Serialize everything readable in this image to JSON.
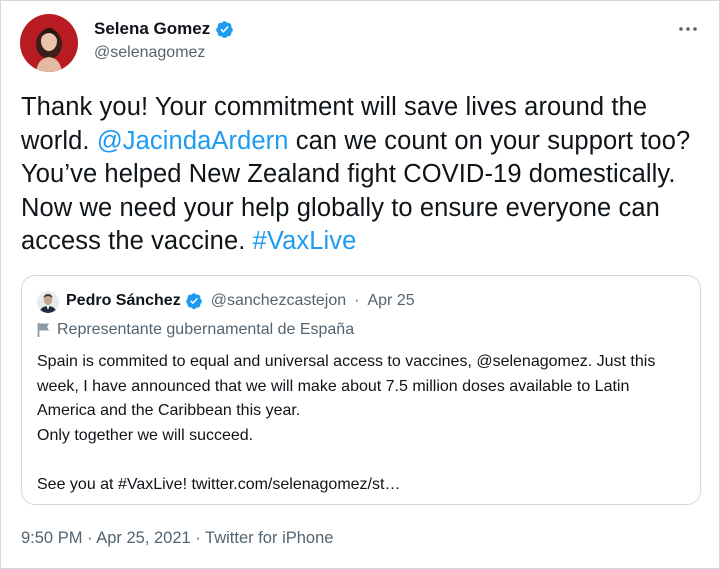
{
  "author": {
    "name": "Selena Gomez",
    "handle": "@selenagomez",
    "verified_icon": "verified-badge-icon",
    "avatar_icon": "avatar-photo"
  },
  "more_icon": "more-options-icon",
  "tweet": {
    "text_1": "Thank you! Your commitment will save lives around the world. ",
    "mention": "@JacindaArdern",
    "text_2": " can we count on your support too? You’ve helped New Zealand fight COVID-19 domestically. Now we need your help globally to ensure everyone can access the vaccine. ",
    "hashtag": "#VaxLive"
  },
  "quote": {
    "name": "Pedro Sánchez",
    "handle": "@sanchezcastejon",
    "separator": "·",
    "date": "Apr 25",
    "label": "Representante gubernamental de España",
    "label_icon": "flag-icon",
    "text": "Spain is commited to equal and universal access to vaccines, @selenagomez. Just this week, I have announced that we will make about 7.5 million doses available to Latin America and the Caribbean this year.\nOnly together we will succeed.\n\nSee you at #VaxLive! twitter.com/selenagomez/st…"
  },
  "footer": {
    "text": "9:50 PM · Apr 25, 2021 · Twitter for iPhone"
  },
  "colors": {
    "link": "#1d9bf0",
    "secondary_text": "#536471",
    "border": "#cfd9de",
    "verified": "#1d9bf0"
  }
}
